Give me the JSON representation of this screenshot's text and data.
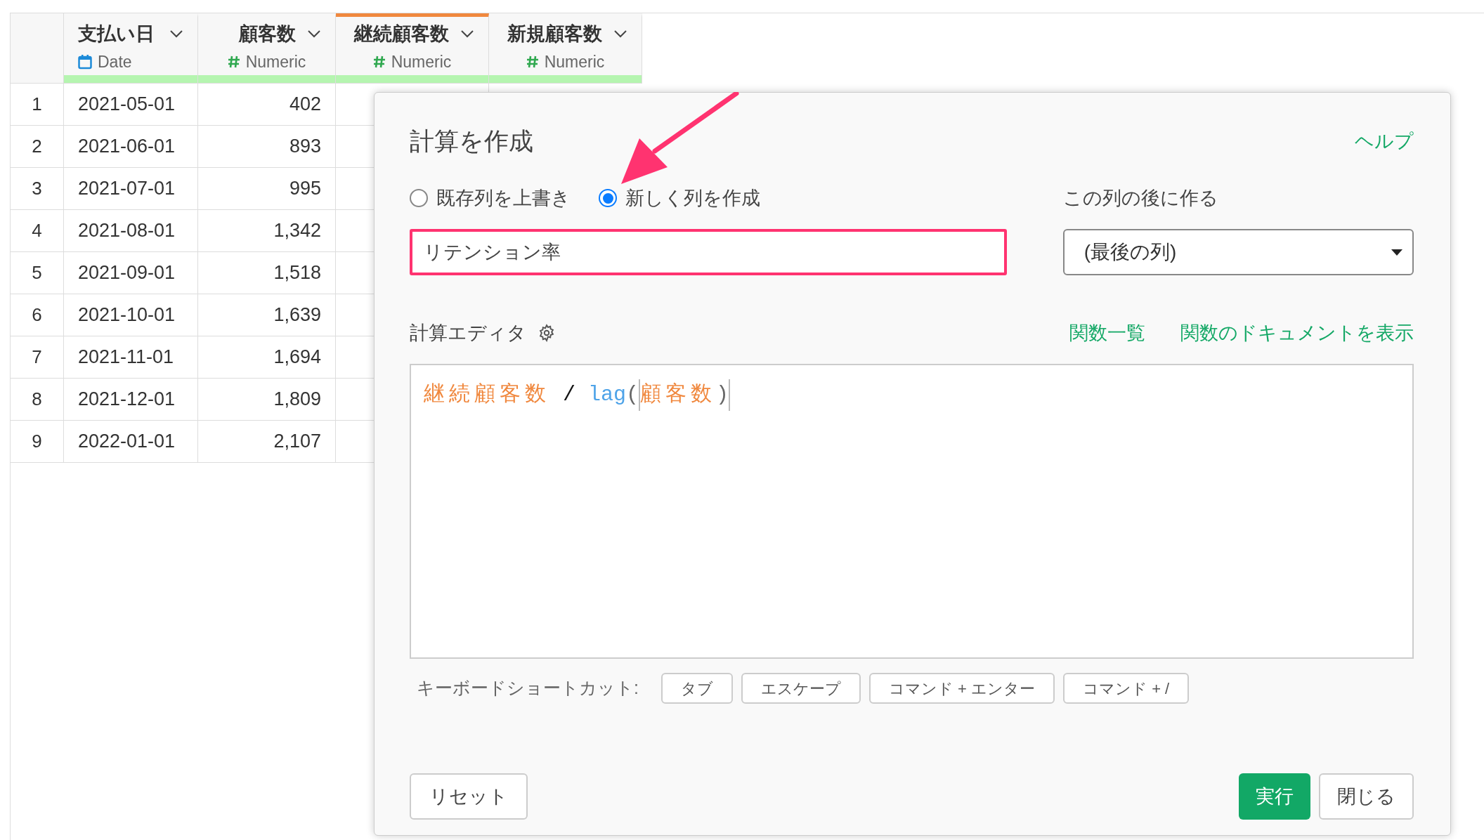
{
  "table": {
    "columns": [
      {
        "name": "支払い日",
        "type_label": "Date",
        "kind": "date",
        "selected": false
      },
      {
        "name": "顧客数",
        "type_label": "Numeric",
        "kind": "numeric",
        "selected": false
      },
      {
        "name": "継続顧客数",
        "type_label": "Numeric",
        "kind": "numeric",
        "selected": true
      },
      {
        "name": "新規顧客数",
        "type_label": "Numeric",
        "kind": "numeric",
        "selected": false
      }
    ],
    "rows": [
      {
        "number": "1",
        "cells": [
          "2021-05-01",
          "402"
        ]
      },
      {
        "number": "2",
        "cells": [
          "2021-06-01",
          "893"
        ]
      },
      {
        "number": "3",
        "cells": [
          "2021-07-01",
          "995"
        ]
      },
      {
        "number": "4",
        "cells": [
          "2021-08-01",
          "1,342"
        ]
      },
      {
        "number": "5",
        "cells": [
          "2021-09-01",
          "1,518"
        ]
      },
      {
        "number": "6",
        "cells": [
          "2021-10-01",
          "1,639"
        ]
      },
      {
        "number": "7",
        "cells": [
          "2021-11-01",
          "1,694"
        ]
      },
      {
        "number": "8",
        "cells": [
          "2021-12-01",
          "1,809"
        ]
      },
      {
        "number": "9",
        "cells": [
          "2022-01-01",
          "2,107"
        ]
      }
    ]
  },
  "dialog": {
    "title": "計算を作成",
    "help_link": "ヘルプ",
    "mode_options": [
      {
        "label": "既存列を上書き",
        "selected": false
      },
      {
        "label": "新しく列を作成",
        "selected": true
      }
    ],
    "column_name": {
      "value": "リテンション率"
    },
    "insert_after": {
      "label": "この列の後に作る",
      "value": "(最後の列)"
    },
    "editor": {
      "label": "計算エディタ",
      "links": [
        "関数一覧",
        "関数のドキュメントを表示"
      ],
      "code": [
        {
          "text": "継続顧客数",
          "kind": "column"
        },
        {
          "text": " / ",
          "kind": "operator"
        },
        {
          "text": "lag",
          "kind": "function"
        },
        {
          "text": "(",
          "kind": "paren"
        },
        {
          "text": "顧客数",
          "kind": "column"
        },
        {
          "text": ")",
          "kind": "paren"
        }
      ]
    },
    "shortcuts": {
      "label": "キーボードショートカット:",
      "keys": [
        "タブ",
        "エスケープ",
        "コマンド + エンター",
        "コマンド + /"
      ]
    },
    "buttons": {
      "reset": "リセット",
      "run": "実行",
      "close": "閉じる"
    }
  }
}
